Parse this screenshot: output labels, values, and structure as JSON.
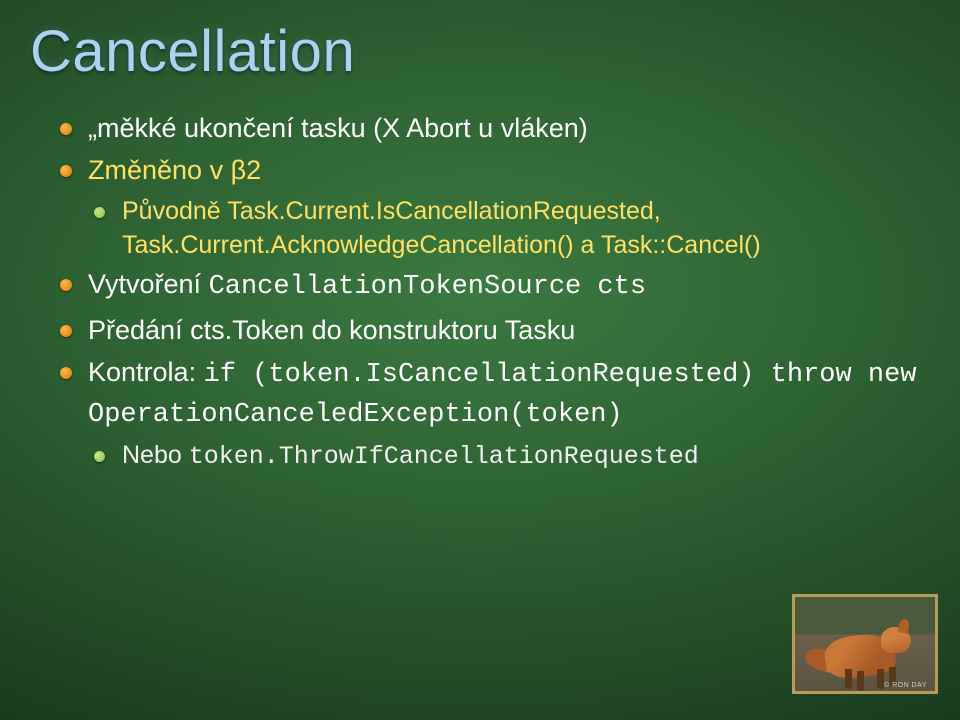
{
  "title": "Cancellation",
  "bullets": {
    "b1": "„měkké ukončení tasku (X Abort u vláken)",
    "b2": "Změněno v β2",
    "b2_sub_a": "Původně Task.Current.IsCancellationRequested, Task.Current.AcknowledgeCancellation() a Task::Cancel()",
    "b3_pre": "Vytvoření ",
    "b3_code": "CancellationTokenSource cts",
    "b4": "Předání cts.Token do konstruktoru Tasku",
    "b5_pre": "Kontrola: ",
    "b5_code1": "if (token.IsCancellationRequested) throw new OperationCanceledException(token)",
    "b5_sub_pre": "Nebo ",
    "b5_sub_code": "token.ThrowIfCancellationRequested"
  },
  "credit": "© RON DAY"
}
